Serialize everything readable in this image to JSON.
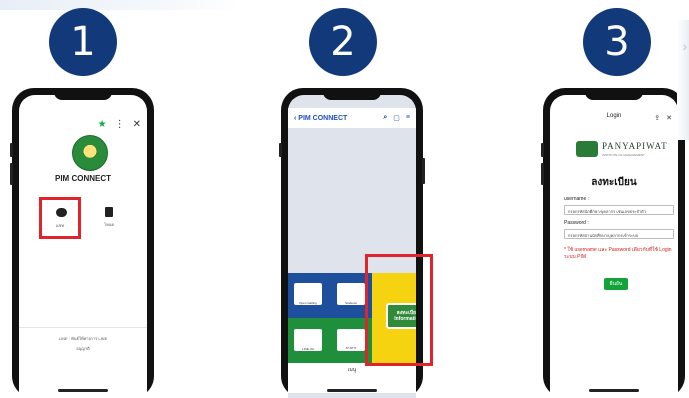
{
  "steps": [
    {
      "number": "1"
    },
    {
      "number": "2"
    },
    {
      "number": "3"
    }
  ],
  "phone1": {
    "brand": "PIM CONNECT",
    "menu_chat": "แชท",
    "menu_home": "โหนด",
    "footer_line1": "LINE · พันธ์ให้ทางการ LINE",
    "footer_line2": "อนุญาติ"
  },
  "phone2": {
    "header_title": "PIM CONNECT",
    "tiles": [
      "Open Gatling",
      "Students",
      "LINE OA",
      "ข่าวสาร"
    ],
    "register_badge": "ลงทะเบียน Information",
    "bottom_label": "เมนู"
  },
  "phone3": {
    "login_title": "Login",
    "university_name": "PANYAPIWAT",
    "university_sub": "INSTITUTE OF MANAGEMENT",
    "form_title": "ลงทะเบียน",
    "username_label": "username :",
    "username_value": "กรอกรหัสนักศึกษา/บุคลากร เช่นเลขประจำตัว",
    "password_label": "Password :",
    "password_value": "กรอกรหัสผ่านนักศึกษา/บุคลากรเข้าระบบ",
    "warning": "* ใช้ username และ Password เดียวกับที่ใช้ Login ระบบ PIM",
    "submit_label": "ยืนยัน"
  },
  "colors": {
    "badge": "#123a7a",
    "highlight_red": "#e0242b",
    "pim_green": "#1aa84a",
    "panel_yellow": "#f5d311"
  },
  "icons": [
    "star-icon",
    "more-icon",
    "close-icon",
    "chat-icon",
    "back-icon",
    "search-icon",
    "bookmark-icon",
    "menu-icon",
    "share-icon",
    "chevron-right-icon"
  ]
}
